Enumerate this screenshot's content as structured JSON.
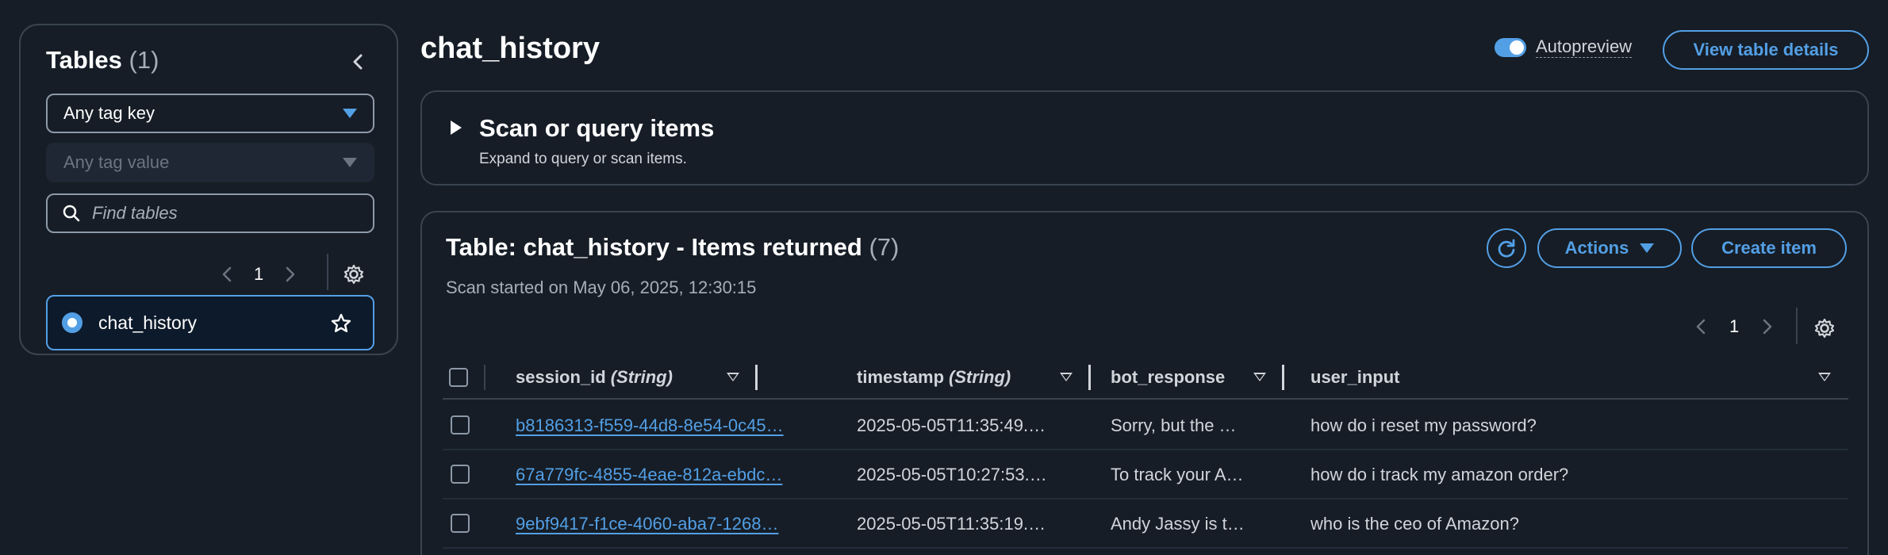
{
  "sidebar": {
    "title": "Tables",
    "count": "(1)",
    "tag_key": "Any tag key",
    "tag_value": "Any tag value",
    "search_placeholder": "Find tables",
    "page": "1",
    "tables": [
      {
        "name": "chat_history"
      }
    ]
  },
  "header": {
    "title": "chat_history",
    "autopreview_label": "Autopreview",
    "autopreview_on": true,
    "view_details_label": "View table details"
  },
  "scan": {
    "title": "Scan or query items",
    "description": "Expand to query or scan items."
  },
  "items": {
    "title": "Table: chat_history - Items returned",
    "count": "(7)",
    "subtitle": "Scan started on May 06, 2025, 12:30:15",
    "actions_label": "Actions",
    "create_label": "Create item",
    "page": "1",
    "columns": [
      {
        "name": "session_id",
        "type": "(String)"
      },
      {
        "name": "timestamp",
        "type": "(String)"
      },
      {
        "name": "bot_response",
        "type": ""
      },
      {
        "name": "user_input",
        "type": ""
      }
    ],
    "rows": [
      {
        "session_id": "b8186313-f559-44d8-8e54-0c45…",
        "timestamp": "2025-05-05T11:35:49.…",
        "bot_response": "Sorry, but the …",
        "user_input": "how do i reset my password?"
      },
      {
        "session_id": "67a779fc-4855-4eae-812a-ebdc…",
        "timestamp": "2025-05-05T10:27:53.…",
        "bot_response": "To track your A…",
        "user_input": "how do i track my amazon order?"
      },
      {
        "session_id": "9ebf9417-f1ce-4060-aba7-1268…",
        "timestamp": "2025-05-05T11:35:19.…",
        "bot_response": "Andy Jassy is t…",
        "user_input": "who is the ceo of Amazon?"
      }
    ]
  },
  "colors": {
    "accent": "#539fe5",
    "background": "#161d26",
    "border": "#3a4350"
  }
}
